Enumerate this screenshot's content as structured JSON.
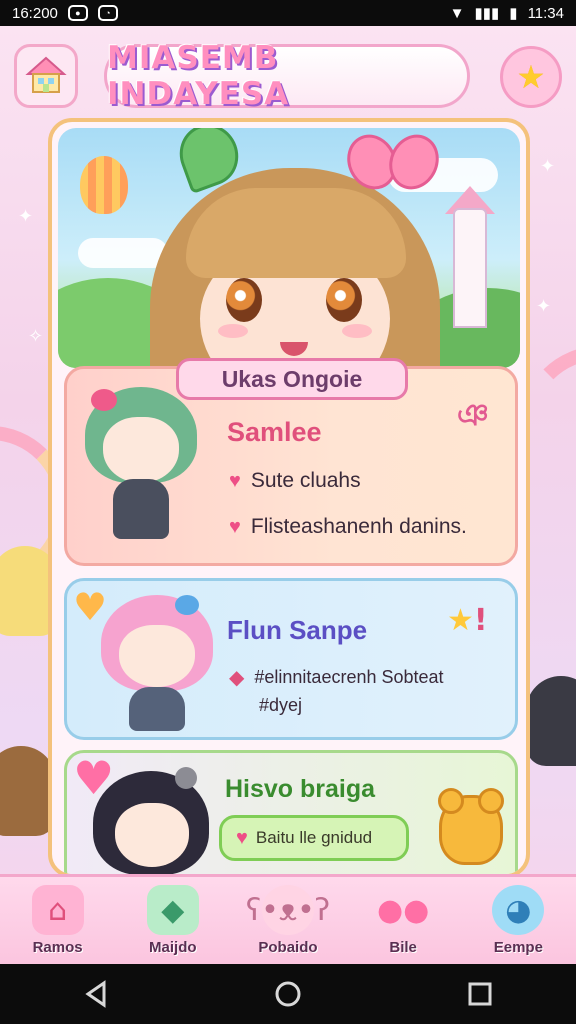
{
  "status_bar": {
    "time_left": "16:200",
    "time_right": "11:34"
  },
  "header": {
    "title": "MIASEMB INDAYESA"
  },
  "panel": {
    "section_tag": "Ukas Ongoie",
    "cards": [
      {
        "title": "Samlee",
        "badge": "ঞ",
        "lines": [
          "Sute cluahs",
          "Flisteashanenh danins."
        ]
      },
      {
        "title": "Flun Sanpe",
        "lines": [
          "#elinnitaecrenh Sobteat",
          "#dyej"
        ]
      },
      {
        "title": "Hisvo braiga",
        "button": "Baitu lle gnidud"
      }
    ]
  },
  "bottom_nav": [
    {
      "label": "Ramos",
      "icon": "house-icon"
    },
    {
      "label": "Maijdo",
      "icon": "gem-icon"
    },
    {
      "label": "Pobaido",
      "icon": "bear-face-icon"
    },
    {
      "label": "Bile",
      "icon": "balloons-icon"
    },
    {
      "label": "Eempe",
      "icon": "whale-icon"
    }
  ],
  "colors": {
    "pink_accent": "#ee4f86",
    "title_pink": "#ff8fbf",
    "title_purple": "#9b5bd0"
  }
}
